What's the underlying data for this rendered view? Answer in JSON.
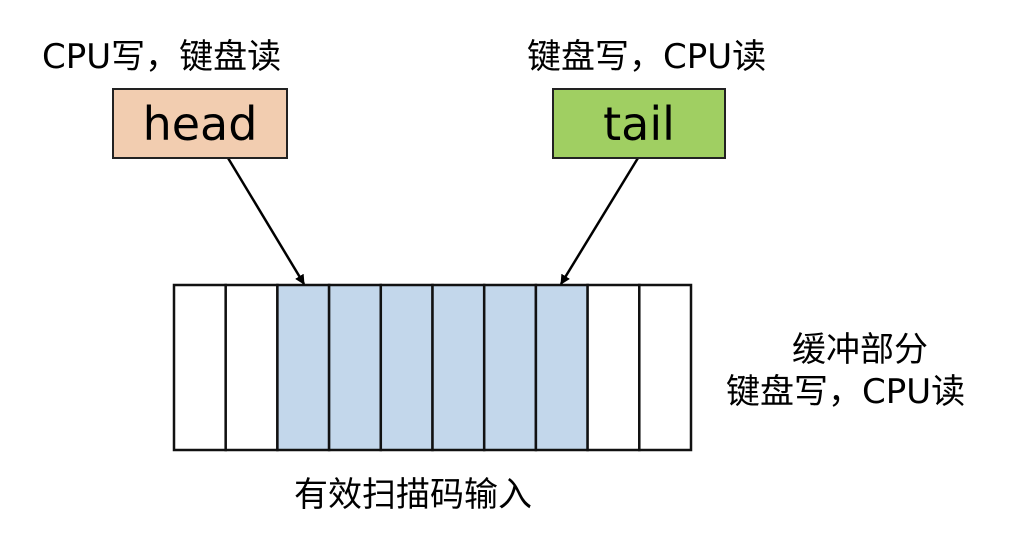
{
  "head": {
    "label": "head",
    "caption": "CPU写，键盘读",
    "color": "#f2cdb0"
  },
  "tail": {
    "label": "tail",
    "caption": "键盘写，CPU读",
    "color": "#a0cf62"
  },
  "buffer": {
    "cell_count": 10,
    "filled_cells": [
      2,
      3,
      4,
      5,
      6,
      7
    ],
    "fill_color": "#c3d7eb",
    "side_label_1": "缓冲部分",
    "side_label_2": "键盘写，CPU读",
    "bottom_label": "有效扫描码输入"
  }
}
